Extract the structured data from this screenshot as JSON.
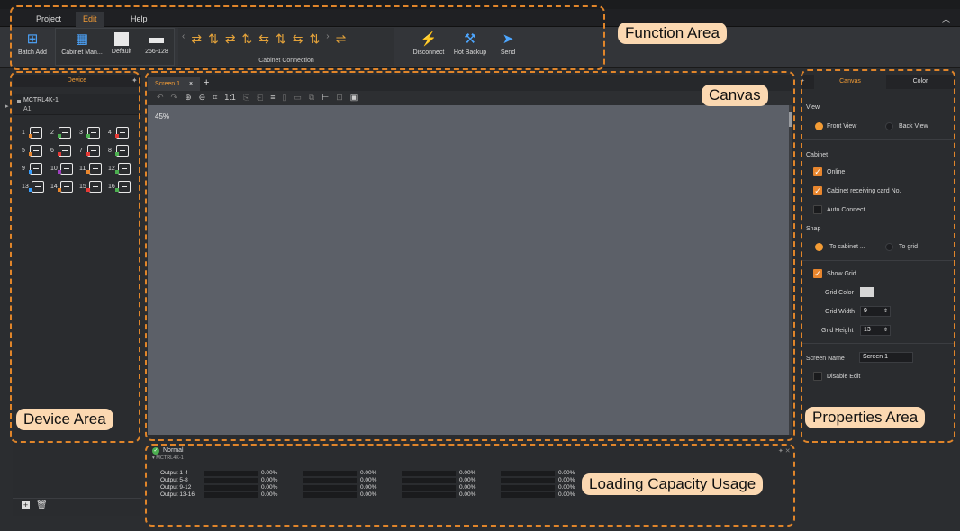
{
  "menu": {
    "items": [
      "Project",
      "Edit",
      "Help"
    ],
    "active": "Edit"
  },
  "ribbon": {
    "batch_add": "Batch Add",
    "cabinet_manager": "Cabinet Man...",
    "default": "Default",
    "size_preset": "256-128",
    "cabinet_connection": "Cabinet Connection",
    "disconnect": "Disconnect",
    "hot_backup": "Hot Backup",
    "send": "Send"
  },
  "callouts": {
    "function_area": "Function Area",
    "canvas": "Canvas",
    "device_area": "Device Area",
    "properties_area": "Properties Area",
    "loading_capacity": "Loading Capacity Usage"
  },
  "device_panel": {
    "title": "Device",
    "device_name": "MCTRL4K-1",
    "device_sub": "A1",
    "ports": [
      "1",
      "2",
      "3",
      "4",
      "5",
      "6",
      "7",
      "8",
      "9",
      "10",
      "11",
      "12",
      "13",
      "14",
      "15",
      "16"
    ],
    "port_colors": [
      "#e8862e",
      "#4caf50",
      "#4caf50",
      "#e53935",
      "#e8862e",
      "#e53935",
      "#e53935",
      "#4caf50",
      "#3aa0ff",
      "#a040c0",
      "#e8862e",
      "#4caf50",
      "#3aa0ff",
      "#e8862e",
      "#e53935",
      "#4caf50"
    ]
  },
  "canvas": {
    "tab_label": "Screen 1",
    "close_icon": "×",
    "add_tab": "+",
    "zoom": "45%"
  },
  "properties": {
    "tabs": [
      "Canvas",
      "Color"
    ],
    "view_label": "View",
    "front_view": "Front View",
    "back_view": "Back View",
    "cabinet_label": "Cabinet",
    "online": "Online",
    "receiving_card": "Cabinet receiving card No.",
    "auto_connect": "Auto Connect",
    "snap_label": "Snap",
    "to_cabinet": "To cabinet ...",
    "to_grid": "To grid",
    "show_grid": "Show Grid",
    "grid_color": "Grid Color",
    "grid_width_label": "Grid Width",
    "grid_width": "9",
    "grid_height_label": "Grid Height",
    "grid_height": "13",
    "screen_name_label": "Screen Name",
    "screen_name": "Screen 1",
    "disable_edit": "Disable Edit"
  },
  "loading": {
    "status": "Normal",
    "device": "MCTRL4K-1",
    "rows": [
      {
        "label": "Output 1-4",
        "values": [
          "0.00%",
          "0.00%",
          "0.00%",
          "0.00%"
        ]
      },
      {
        "label": "Output 5-8",
        "values": [
          "0.00%",
          "0.00%",
          "0.00%",
          "0.00%"
        ]
      },
      {
        "label": "Output 9-12",
        "values": [
          "0.00%",
          "0.00%",
          "0.00%",
          "0.00%"
        ]
      },
      {
        "label": "Output 13-16",
        "values": [
          "0.00%",
          "0.00%",
          "0.00%",
          "0.00%"
        ]
      }
    ]
  }
}
